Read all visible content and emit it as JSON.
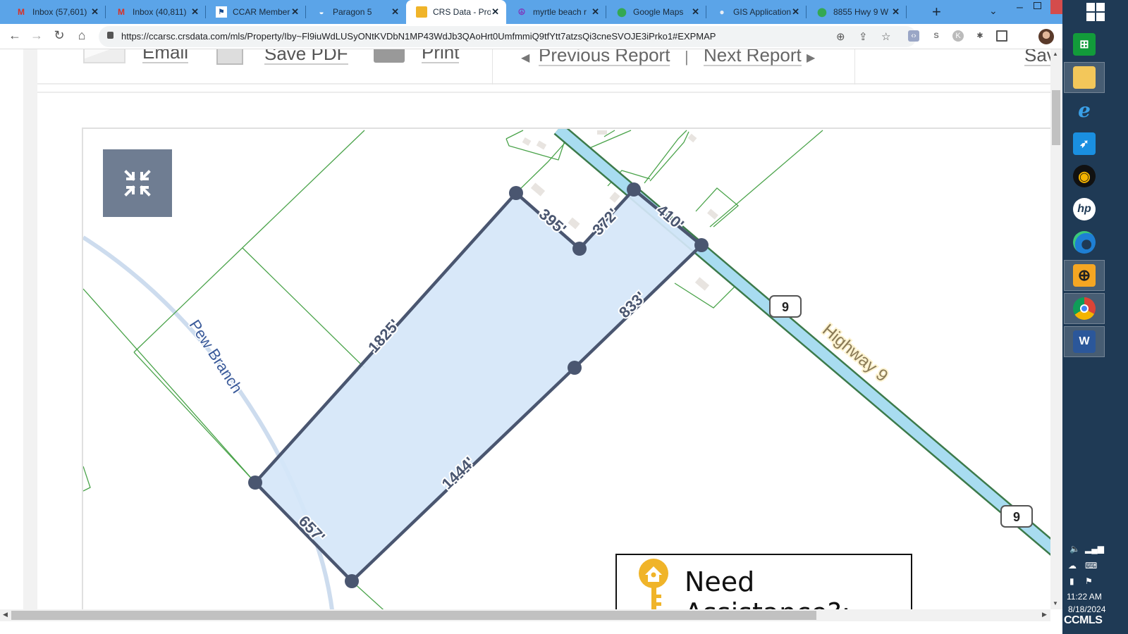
{
  "browser": {
    "tabs": [
      {
        "title": "Inbox (57,601)",
        "icon": "gmail-icon",
        "active": false
      },
      {
        "title": "Inbox (40,811)",
        "icon": "gmail-icon",
        "active": false
      },
      {
        "title": "CCAR Member",
        "icon": "ccar-icon",
        "active": false
      },
      {
        "title": "Paragon 5",
        "icon": "paragon-icon",
        "active": false
      },
      {
        "title": "CRS Data - Pro",
        "icon": "crs-icon",
        "active": true
      },
      {
        "title": "myrtle beach r",
        "icon": "peace-icon",
        "active": false
      },
      {
        "title": "Google Maps",
        "icon": "maps-pin-icon",
        "active": false
      },
      {
        "title": "GIS Application",
        "icon": "gis-icon",
        "active": false
      },
      {
        "title": "8855 Hwy 9 W",
        "icon": "maps-pin-icon",
        "active": false
      }
    ],
    "new_tab": "+",
    "url": "https://ccarsc.crsdata.com/mls/Property/Iby~Fl9iuWdLUSyONtKVDbN1MP43WdJb3QAoHrt0UmfmmiQ9tfYtt7atzsQi3cneSVOJE3iPrko1#EXPMAP",
    "window_controls": {
      "minimize": "–",
      "close": "✕"
    }
  },
  "report_bar": {
    "email": "Email",
    "save_pdf": "Save PDF",
    "print": "Print",
    "previous": "Previous Report",
    "separator": "|",
    "next": "Next Report",
    "save_cut": "Sav"
  },
  "map": {
    "parcel_edges": [
      {
        "label": "1825'"
      },
      {
        "label": "395'"
      },
      {
        "label": "372'"
      },
      {
        "label": "410'"
      },
      {
        "label": "833'"
      },
      {
        "label": "1444'"
      },
      {
        "label": "657'"
      }
    ],
    "road_label": "Highway 9",
    "route_shields": [
      "9",
      "9"
    ],
    "stream_label": "Pew Branch",
    "colors": {
      "parcel_fill": "#d5e6f8",
      "parcel_stroke": "#4a5670",
      "road_fill": "#a8dcf0",
      "road_edge": "#3c7a4a",
      "parcel_lines": "#4aa34a",
      "stream": "#c5d8ee"
    }
  },
  "assist": {
    "text": "Need Assistance?:"
  },
  "taskbar": {
    "apps": [
      {
        "name": "store",
        "glyph": "🛍"
      },
      {
        "name": "file-explorer",
        "glyph": "📁"
      },
      {
        "name": "internet-explorer",
        "glyph": "e"
      },
      {
        "name": "rocket-app",
        "glyph": "🚀"
      },
      {
        "name": "webcam-app",
        "glyph": "◉"
      },
      {
        "name": "hp",
        "glyph": "hp"
      },
      {
        "name": "edge",
        "glyph": "e"
      },
      {
        "name": "globe-app",
        "glyph": "🌐"
      },
      {
        "name": "chrome",
        "glyph": "◎"
      },
      {
        "name": "word",
        "glyph": "W"
      }
    ],
    "time": "11:22 AM",
    "date": "8/18/2024",
    "brand": "CCMLS"
  }
}
